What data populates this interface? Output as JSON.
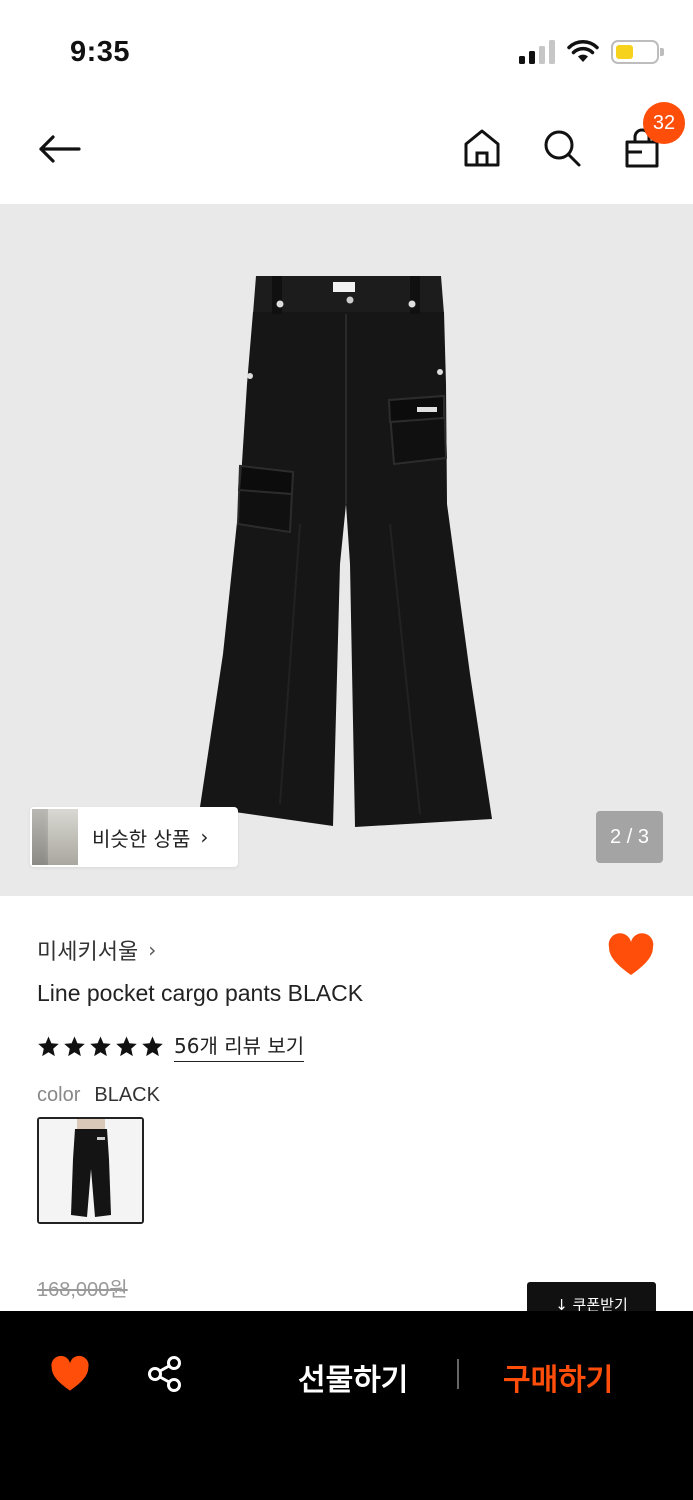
{
  "status_bar": {
    "time": "9:35"
  },
  "top_nav": {
    "cart_count": "32",
    "icons": [
      "back-arrow-icon",
      "home-icon",
      "search-icon",
      "shopping-bag-icon"
    ]
  },
  "gallery": {
    "similar_label": "비슷한 상품",
    "similar_chevron": "›",
    "page_indicator": "2 / 3"
  },
  "product": {
    "brand": "미세키서울",
    "brand_chevron": "›",
    "title": "Line pocket cargo pants BLACK",
    "rating_stars": 5,
    "review_link": "56개 리뷰 보기",
    "color_label": "color",
    "color_value": "BLACK",
    "original_price": "168,000원",
    "coupon_label": "↓ 쿠폰받기",
    "wishlisted": true
  },
  "bottom_bar": {
    "gift_label": "선물하기",
    "buy_label": "구매하기"
  },
  "colors": {
    "accent": "#ff4d0a",
    "bottom_bar_bg": "#000000",
    "gallery_bg": "#e9e9e9"
  }
}
